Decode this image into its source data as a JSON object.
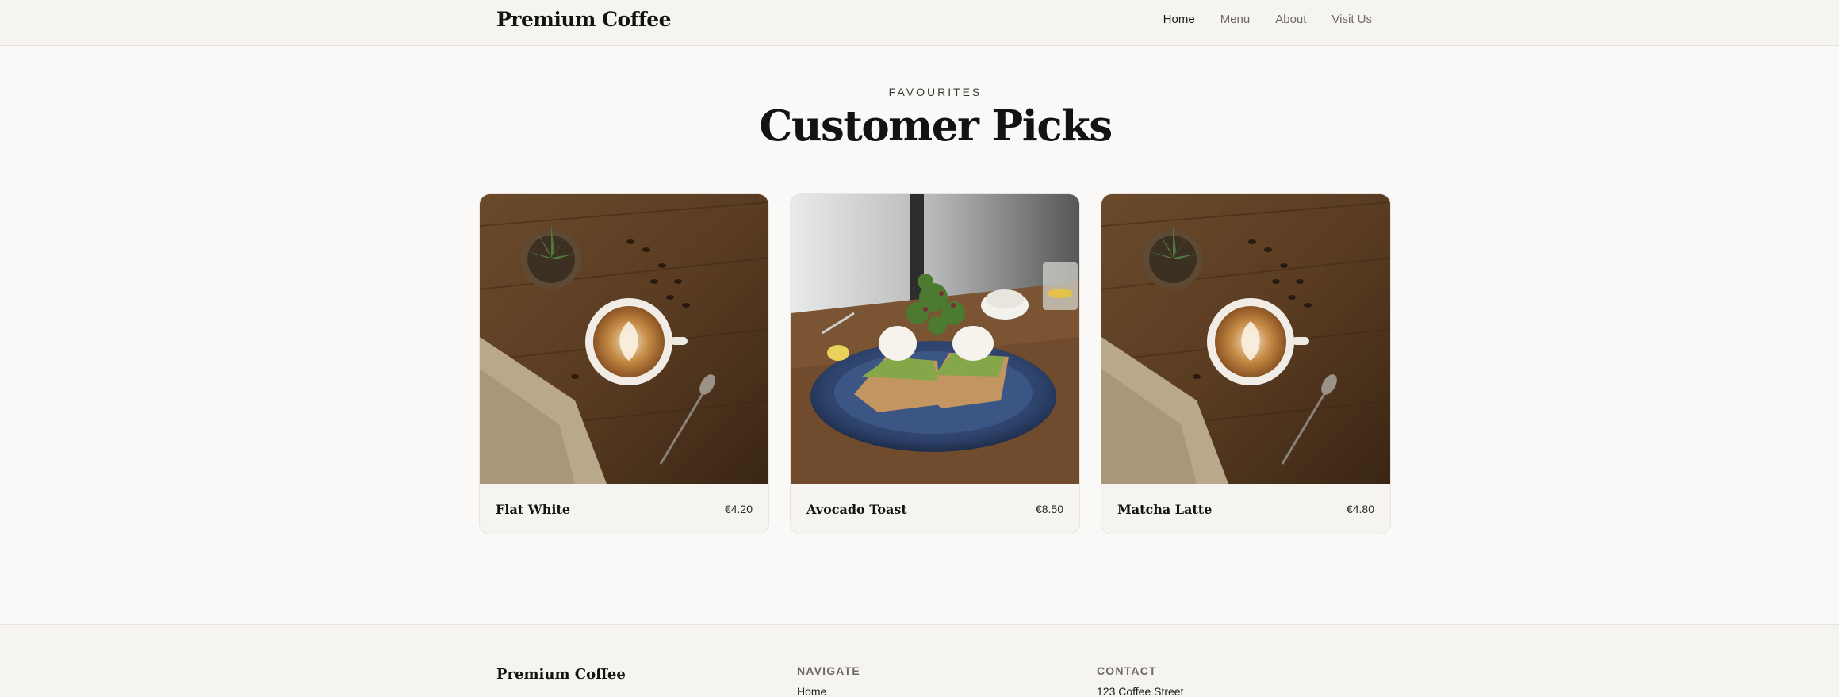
{
  "header": {
    "brand": "Premium Coffee",
    "nav": [
      "Home",
      "Menu",
      "About",
      "Visit Us"
    ],
    "active_nav": "Home"
  },
  "section": {
    "eyebrow": "FAVOURITES",
    "title": "Customer Picks"
  },
  "cards": [
    {
      "name": "Flat White",
      "price": "€4.20",
      "image": "latte-art-coffee-photo"
    },
    {
      "name": "Avocado Toast",
      "price": "€8.50",
      "image": "avocado-toast-photo"
    },
    {
      "name": "Matcha Latte",
      "price": "€4.80",
      "image": "latte-art-coffee-photo"
    }
  ],
  "footer": {
    "brand": "Premium Coffee",
    "navigate_heading": "NAVIGATE",
    "navigate_first": "Home",
    "contact_heading": "CONTACT",
    "contact_first": "123 Coffee Street"
  },
  "colors": {
    "background": "#faf9f7",
    "header_bg": "#f5f4f1",
    "text": "#141311",
    "muted": "#6e6a64",
    "border": "#e6e3de"
  }
}
